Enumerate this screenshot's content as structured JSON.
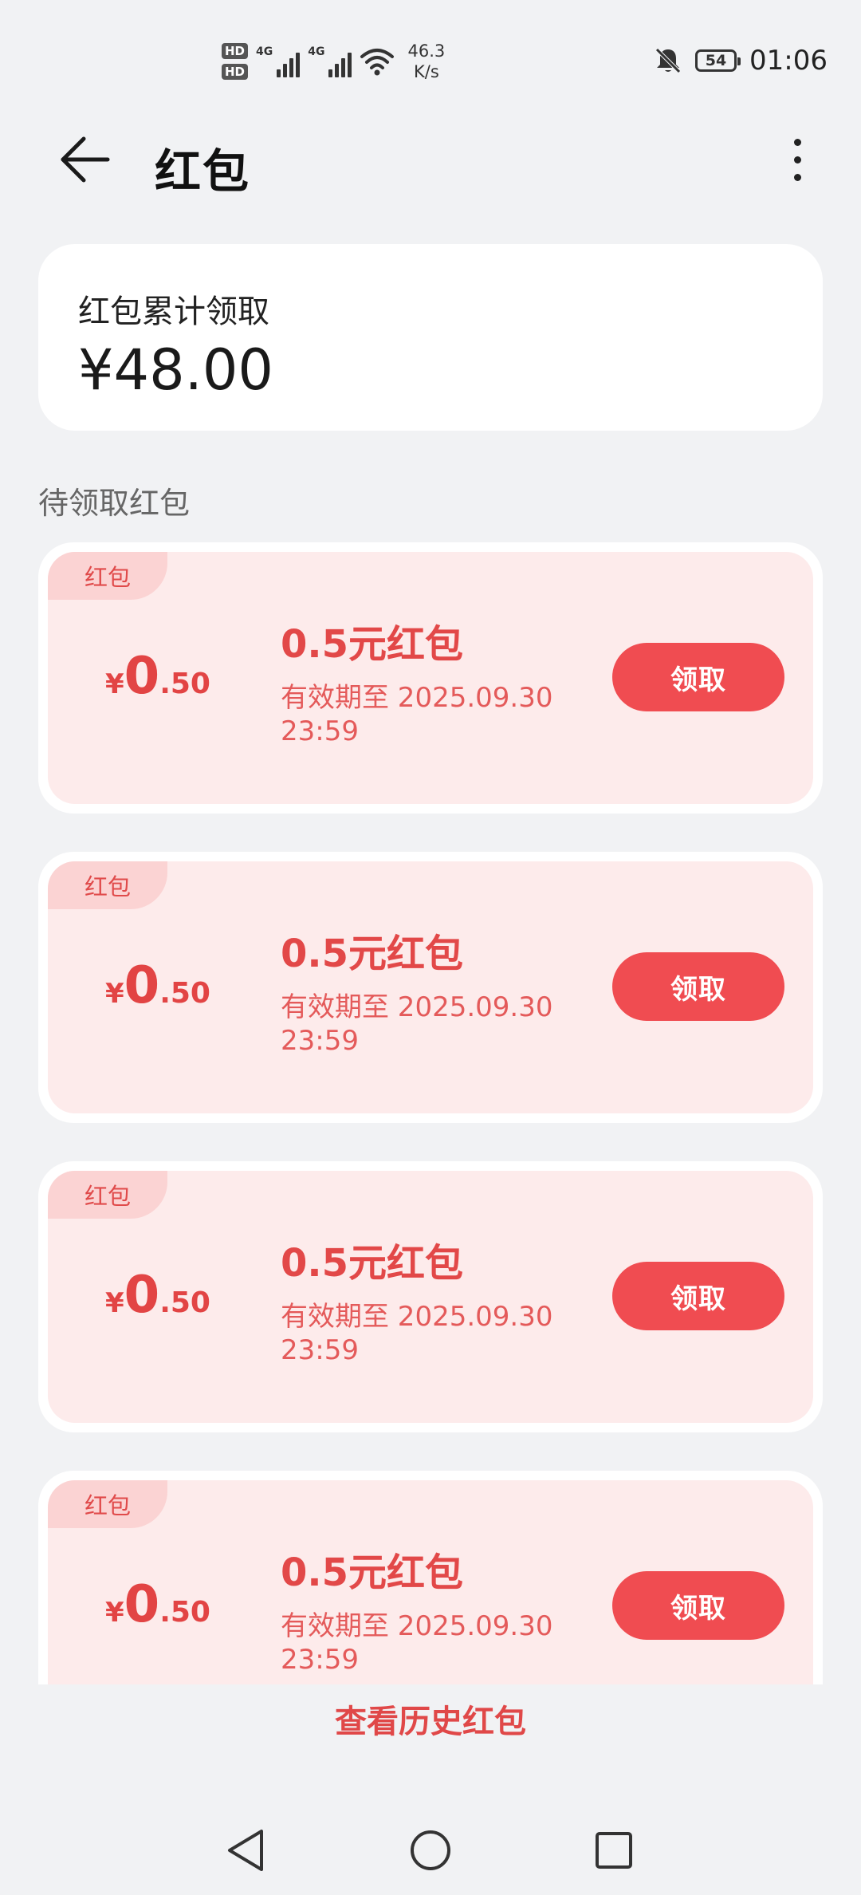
{
  "status_bar": {
    "hd1": "HD",
    "hd2": "HD",
    "net1": "4G",
    "net2": "4G",
    "speed_value": "46.3",
    "speed_unit": "K/s",
    "battery": "54",
    "time": "01:06",
    "icons": [
      "signal-icon",
      "wifi-icon",
      "bell-off-icon",
      "battery-icon"
    ]
  },
  "header": {
    "title": "红包",
    "back_icon": "arrow-left-icon",
    "more_icon": "more-vertical-icon"
  },
  "summary": {
    "label": "红包累计领取",
    "amount": "¥48.00"
  },
  "section_title": "待领取红包",
  "coupons": [
    {
      "tag": "红包",
      "currency": "¥",
      "int": "0",
      "dec": ".50",
      "title": "0.5元红包",
      "expiry": "有效期至 2025.09.30 23:59",
      "button": "领取"
    },
    {
      "tag": "红包",
      "currency": "¥",
      "int": "0",
      "dec": ".50",
      "title": "0.5元红包",
      "expiry": "有效期至 2025.09.30 23:59",
      "button": "领取"
    },
    {
      "tag": "红包",
      "currency": "¥",
      "int": "0",
      "dec": ".50",
      "title": "0.5元红包",
      "expiry": "有效期至 2025.09.30 23:59",
      "button": "领取"
    },
    {
      "tag": "红包",
      "currency": "¥",
      "int": "0",
      "dec": ".50",
      "title": "0.5元红包",
      "expiry": "有效期至 2025.09.30 23:59",
      "button": "领取"
    }
  ],
  "history_link": "查看历史红包",
  "nav": {
    "icons": [
      "back-triangle-icon",
      "home-circle-icon",
      "recents-square-icon"
    ]
  },
  "colors": {
    "accent": "#f04c51",
    "coupon_bg": "#fdebeb",
    "tag_bg": "#fbd3d3",
    "page_bg": "#f1f2f4"
  }
}
